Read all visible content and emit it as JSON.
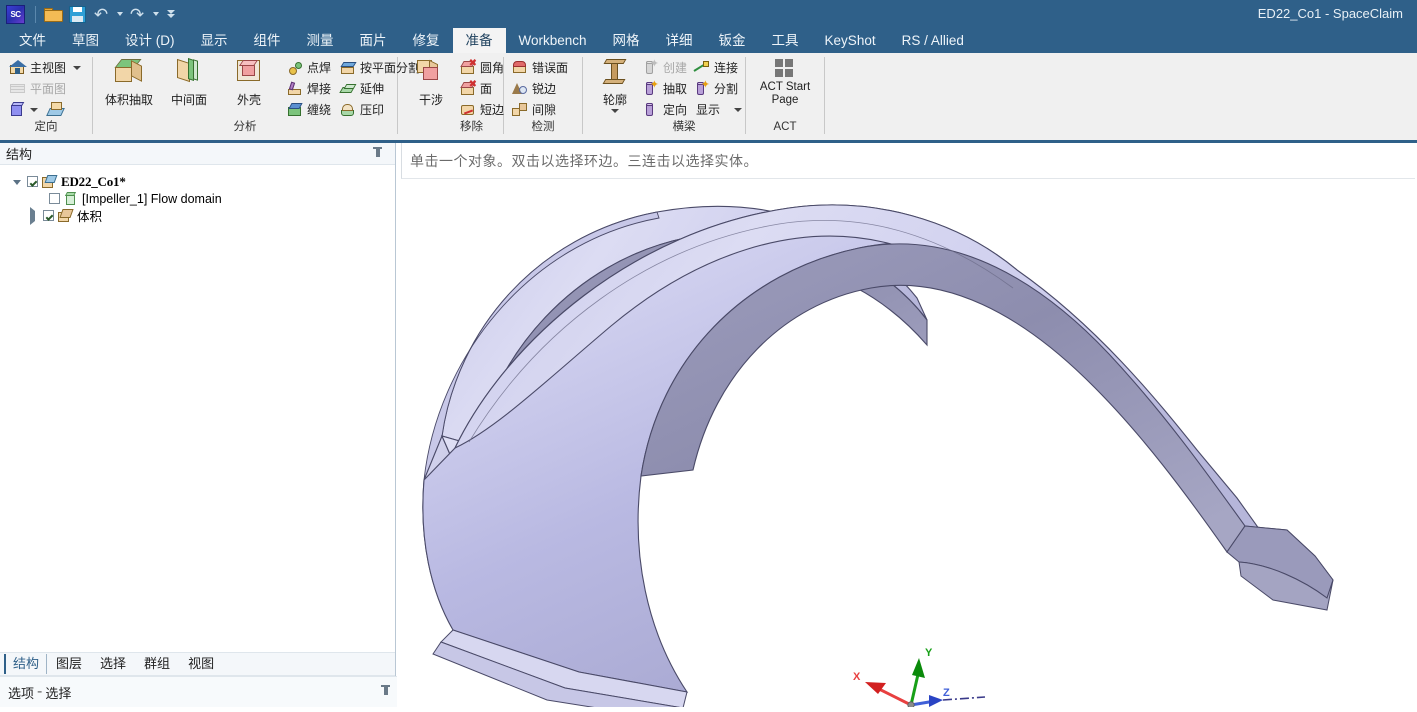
{
  "titlebar": {
    "app_title": "ED22_Co1 - SpaceClaim",
    "logo_text": "SC",
    "quick_access": [
      {
        "name": "open-icon",
        "label": "打开"
      },
      {
        "name": "save-icon",
        "label": "保存"
      },
      {
        "name": "undo-icon",
        "label": "撤消"
      },
      {
        "name": "redo-icon",
        "label": "恢复"
      },
      {
        "name": "customize-qat-icon",
        "label": "自定义快速访问工具栏"
      }
    ]
  },
  "ribbon_tabs": [
    {
      "label": "文件",
      "active": false
    },
    {
      "label": "草图",
      "active": false
    },
    {
      "label": "设计 (D)",
      "active": false
    },
    {
      "label": "显示",
      "active": false
    },
    {
      "label": "组件",
      "active": false
    },
    {
      "label": "测量",
      "active": false
    },
    {
      "label": "面片",
      "active": false
    },
    {
      "label": "修复",
      "active": false
    },
    {
      "label": "准备",
      "active": true
    },
    {
      "label": "Workbench",
      "active": false
    },
    {
      "label": "网格",
      "active": false
    },
    {
      "label": "详细",
      "active": false
    },
    {
      "label": "钣金",
      "active": false
    },
    {
      "label": "工具",
      "active": false
    },
    {
      "label": "KeyShot",
      "active": false
    },
    {
      "label": "RS / Allied",
      "active": false
    }
  ],
  "ribbon_groups": {
    "orientation": {
      "label": "定向",
      "items": [
        {
          "label": "主视图",
          "icon": "home-icon",
          "disabled": false,
          "has_dropdown": true
        },
        {
          "label": "平面图",
          "icon": "plan-view-icon",
          "disabled": true,
          "has_dropdown": false
        },
        {
          "label": "",
          "icon": "isometric-box-icon",
          "disabled": false,
          "has_dropdown": true
        },
        {
          "label": "",
          "icon": "orient-icon",
          "disabled": false,
          "has_dropdown": false
        }
      ]
    },
    "analysis": {
      "label": "分析",
      "big_items": [
        {
          "label": "体积抽取",
          "icon": "volume-extract-icon"
        },
        {
          "label": "中间面",
          "icon": "midsurface-icon"
        },
        {
          "label": "外壳",
          "icon": "enclosure-icon"
        }
      ],
      "small_items_col1": [
        {
          "label": "点焊",
          "icon": "spot-weld-icon"
        },
        {
          "label": "焊接",
          "icon": "weld-icon"
        },
        {
          "label": "缠绕",
          "icon": "wrap-icon"
        }
      ],
      "small_items_col2": [
        {
          "label": "按平面分割",
          "icon": "split-by-plane-icon"
        },
        {
          "label": "延伸",
          "icon": "extend-icon"
        },
        {
          "label": "压印",
          "icon": "imprint-icon"
        }
      ]
    },
    "remove": {
      "label": "移除",
      "big_items": [
        {
          "label": "干涉",
          "icon": "interference-icon"
        }
      ],
      "small_items": [
        {
          "label": "圆角",
          "icon": "remove-round-icon"
        },
        {
          "label": "面",
          "icon": "remove-face-icon"
        },
        {
          "label": "短边",
          "icon": "short-edge-icon"
        }
      ]
    },
    "detect": {
      "label": "检测",
      "small_items": [
        {
          "label": "错误面",
          "icon": "error-face-icon"
        },
        {
          "label": "锐边",
          "icon": "sharp-edge-icon"
        },
        {
          "label": "间隙",
          "icon": "gap-icon"
        }
      ]
    },
    "beam": {
      "label": "横梁",
      "big_items": [
        {
          "label": "轮廓",
          "icon": "profile-icon",
          "has_dropdown": true
        }
      ],
      "small_items_col1": [
        {
          "label": "创建",
          "icon": "beam-create-icon",
          "disabled": true
        },
        {
          "label": "抽取",
          "icon": "beam-extract-icon",
          "disabled": false
        },
        {
          "label": "定向",
          "icon": "beam-orient-icon",
          "disabled": false
        }
      ],
      "small_items_col2": [
        {
          "label": "连接",
          "icon": "beam-connect-icon",
          "disabled": false
        },
        {
          "label": "分割",
          "icon": "beam-split-icon",
          "disabled": false
        },
        {
          "label": "显示",
          "icon": "beam-display-icon",
          "disabled": false,
          "has_dropdown": true
        }
      ]
    },
    "act": {
      "label": "ACT",
      "big_items": [
        {
          "label": "ACT Start Page",
          "icon": "act-start-page-icon"
        }
      ]
    }
  },
  "structure_panel": {
    "header": "结构",
    "pin_tooltip": "自动隐藏",
    "tree": [
      {
        "label": "ED22_Co1*",
        "indent": 0,
        "expander": "expanded",
        "checkbox": "checked",
        "icon": "document-icon",
        "style": "document"
      },
      {
        "label": "[Impeller_1] Flow domain",
        "indent": 1,
        "expander": "none",
        "checkbox": "unchecked",
        "icon": "green-body-icon",
        "style": "normal"
      },
      {
        "label": "体积",
        "indent": 1,
        "expander": "collapsed",
        "checkbox": "checked",
        "icon": "volume-body-icon",
        "style": "normal"
      }
    ],
    "bottom_tabs": [
      {
        "label": "结构",
        "active": true
      },
      {
        "label": "图层",
        "active": false
      },
      {
        "label": "选择",
        "active": false
      },
      {
        "label": "群组",
        "active": false
      },
      {
        "label": "视图",
        "active": false
      }
    ],
    "options_bar": {
      "prefix": "选项",
      "separator": "-",
      "suffix": "选择"
    }
  },
  "viewport": {
    "hint_text": "单击一个对象。双击以选择环边。三连击以选择实体。",
    "model_name": "impeller-blade-solid",
    "model_colors": {
      "light": "#d2d2f0",
      "mid": "#b9b9e4",
      "dark": "#8f8fae",
      "edge": "#4a4a6a"
    },
    "axes": [
      {
        "label": "X",
        "color": "#e03030"
      },
      {
        "label": "Y",
        "color": "#10a010"
      },
      {
        "label": "Z",
        "color": "#3050d0"
      }
    ]
  },
  "colors": {
    "title_bar": "#2f6089",
    "ribbon_bg": "#f0f0f0",
    "active_tab_bg": "#f4f4f4",
    "accent": "#2f6089"
  }
}
